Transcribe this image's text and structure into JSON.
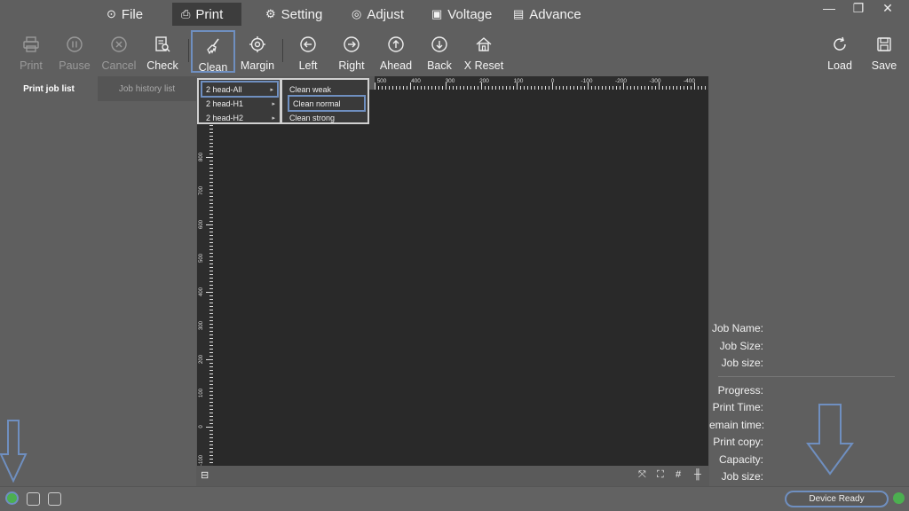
{
  "menu": {
    "file": "File",
    "print": "Print",
    "setting": "Setting",
    "adjust": "Adjust",
    "voltage": "Voltage",
    "advance": "Advance",
    "active": "Print"
  },
  "toolbar": {
    "print": "Print",
    "pause": "Pause",
    "cancel": "Cancel",
    "check": "Check",
    "clean": "Clean",
    "margin": "Margin",
    "left": "Left",
    "right": "Right",
    "ahead": "Ahead",
    "back": "Back",
    "x_reset": "X Reset",
    "load": "Load",
    "save": "Save"
  },
  "left_panel": {
    "tab_print": "Print job list",
    "tab_history": "Job history list"
  },
  "clean_menu": {
    "items": [
      "2 head-All",
      "2 head-H1",
      "2 head-H2"
    ],
    "submenu": [
      "Clean weak",
      "Clean normal",
      "Clean strong"
    ]
  },
  "ruler": {
    "h_ticks": [
      "500",
      "400",
      "300",
      "200",
      "100",
      "0",
      "-100",
      "-200",
      "-300",
      "-400"
    ],
    "v_ticks": [
      "800",
      "700",
      "600",
      "500",
      "400",
      "300",
      "200",
      "100",
      "0",
      "-100"
    ]
  },
  "job_info": {
    "job_name": "Job Name:",
    "job_size_1": "Job Size:",
    "job_size_2": "Job size:",
    "progress": "Progress:",
    "print_time": "Print Time:",
    "remain_time": "emain time:",
    "print_copy": "Print copy:",
    "capacity": "Capacity:",
    "job_size_3": "Job size:"
  },
  "status": {
    "device_ready": "Device Ready"
  },
  "colors": {
    "background": "#5f5f5f",
    "board": "#292929",
    "highlight": "#6f8fc0",
    "status_green": "#4caf50"
  }
}
